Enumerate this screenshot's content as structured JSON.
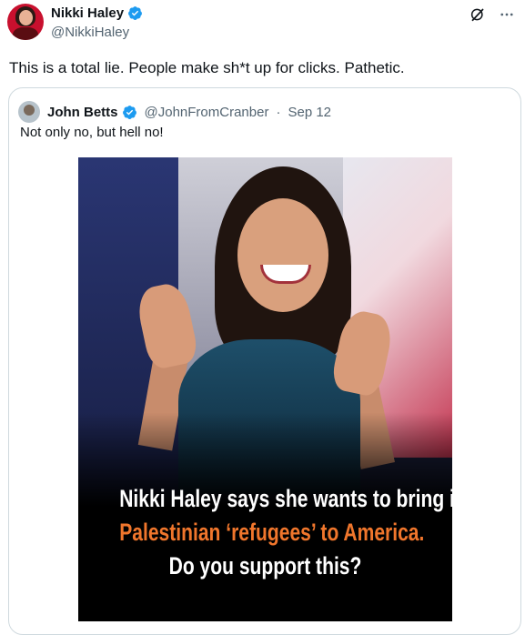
{
  "author": {
    "name": "Nikki Haley",
    "handle": "@NikkiHaley",
    "verified": true
  },
  "post": {
    "text": "This is a total lie. People make sh*t up for clicks. Pathetic."
  },
  "icons": {
    "top_right": [
      "grok-icon",
      "more-icon"
    ],
    "verified_color": "#1d9bf0"
  },
  "quoted": {
    "name": "John Betts",
    "handle": "@JohnFromCranber",
    "separator": "·",
    "date": "Sep 12",
    "verified": true,
    "text": "Not only no, but hell no!",
    "media": {
      "caption_line1": "Nikki Haley says she wants to bring in",
      "caption_line2": "Palestinian ‘refugees’ to America.",
      "caption_line3": "Do you support this?",
      "caption_accent_color": "#f0762c"
    }
  },
  "colors": {
    "text": "#0f1419",
    "secondary": "#536471",
    "border": "#cfd9de"
  }
}
